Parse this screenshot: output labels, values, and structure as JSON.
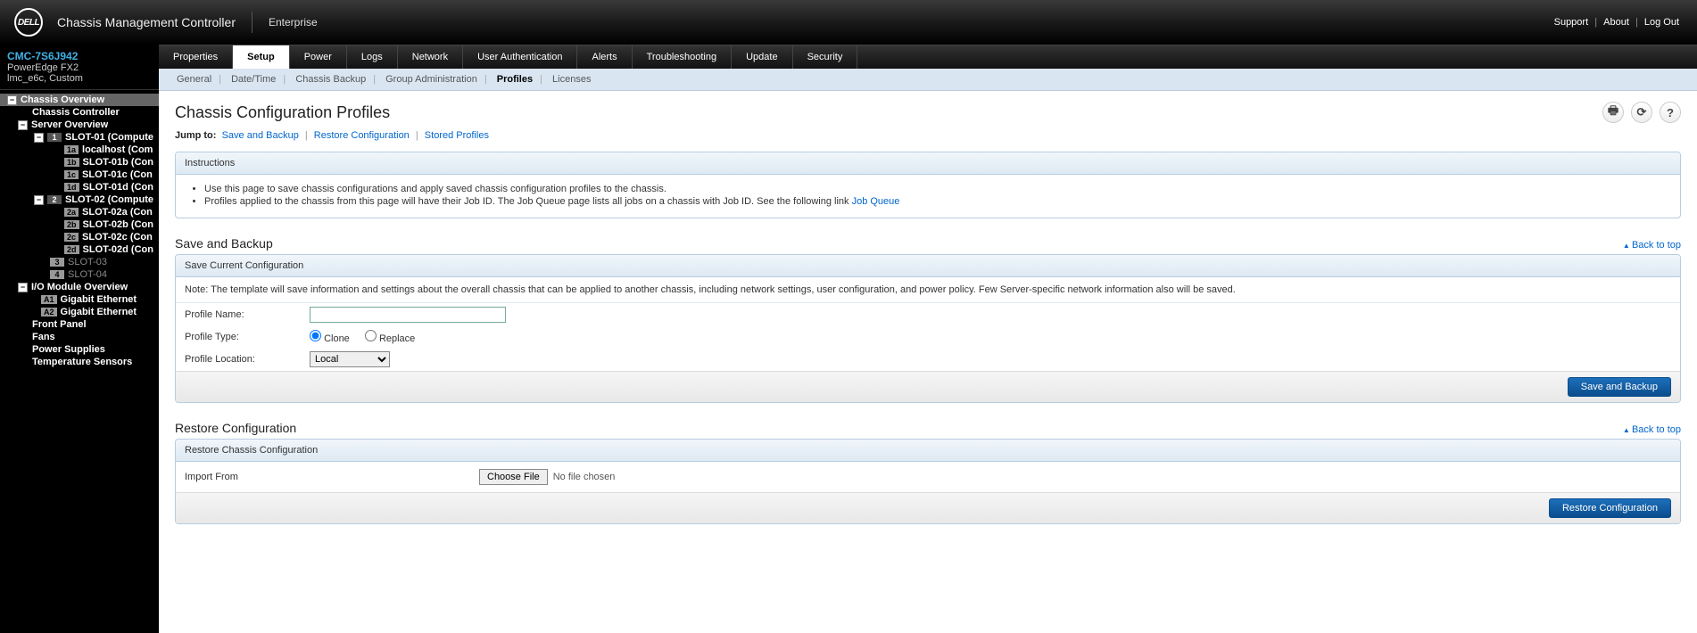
{
  "header": {
    "logo_text": "DELL",
    "title": "Chassis Management Controller",
    "subtitle": "Enterprise",
    "links": {
      "support": "Support",
      "about": "About",
      "logout": "Log Out"
    }
  },
  "sidebar": {
    "device": "CMC-7S6J942",
    "model": "PowerEdge FX2",
    "extra": "lmc_e6c, Custom",
    "tree": {
      "chassis_overview": "Chassis Overview",
      "chassis_controller": "Chassis Controller",
      "server_overview": "Server Overview",
      "slot01": {
        "badge": "1",
        "label": "SLOT-01 (Compute"
      },
      "slot01a": {
        "badge": "1a",
        "label": "localhost (Com"
      },
      "slot01b": {
        "badge": "1b",
        "label": "SLOT-01b (Con"
      },
      "slot01c": {
        "badge": "1c",
        "label": "SLOT-01c (Con"
      },
      "slot01d": {
        "badge": "1d",
        "label": "SLOT-01d (Con"
      },
      "slot02": {
        "badge": "2",
        "label": "SLOT-02 (Compute"
      },
      "slot02a": {
        "badge": "2a",
        "label": "SLOT-02a (Con"
      },
      "slot02b": {
        "badge": "2b",
        "label": "SLOT-02b (Con"
      },
      "slot02c": {
        "badge": "2c",
        "label": "SLOT-02c (Con"
      },
      "slot02d": {
        "badge": "2d",
        "label": "SLOT-02d (Con"
      },
      "slot03": {
        "badge": "3",
        "label": "SLOT-03"
      },
      "slot04": {
        "badge": "4",
        "label": "SLOT-04"
      },
      "io_overview": "I/O Module Overview",
      "ioA1": {
        "badge": "A1",
        "label": "Gigabit Ethernet"
      },
      "ioA2": {
        "badge": "A2",
        "label": "Gigabit Ethernet"
      },
      "front_panel": "Front Panel",
      "fans": "Fans",
      "power_supplies": "Power Supplies",
      "temp_sensors": "Temperature Sensors"
    }
  },
  "tabs": {
    "main": [
      "Properties",
      "Setup",
      "Power",
      "Logs",
      "Network",
      "User Authentication",
      "Alerts",
      "Troubleshooting",
      "Update",
      "Security"
    ],
    "active_main": "Setup",
    "sub": [
      "General",
      "Date/Time",
      "Chassis Backup",
      "Group Administration",
      "Profiles",
      "Licenses"
    ],
    "active_sub": "Profiles"
  },
  "page": {
    "title": "Chassis Configuration Profiles",
    "jump_label": "Jump to:",
    "jump_links": [
      "Save and Backup",
      "Restore Configuration",
      "Stored Profiles"
    ],
    "back_to_top": "Back to top"
  },
  "instructions": {
    "header": "Instructions",
    "line1": "Use this page to save chassis configurations and apply saved chassis configuration profiles to the chassis.",
    "line2a": "Profiles applied to the chassis from this page will have their Job ID. The Job Queue page lists all jobs on a chassis with Job ID. See the following link ",
    "line2_link": "Job Queue"
  },
  "save_backup": {
    "section_title": "Save and Backup",
    "panel_header": "Save Current Configuration",
    "note": "Note: The template will save information and settings about the overall chassis that can be applied to another chassis, including network settings, user configuration, and power policy. Few Server-specific network information also will be saved.",
    "profile_name_label": "Profile Name:",
    "profile_name_value": "",
    "profile_type_label": "Profile Type:",
    "profile_type_clone": "Clone",
    "profile_type_replace": "Replace",
    "profile_location_label": "Profile Location:",
    "profile_location_value": "Local",
    "button": "Save and Backup"
  },
  "restore": {
    "section_title": "Restore Configuration",
    "panel_header": "Restore Chassis Configuration",
    "import_label": "Import From",
    "choose_file": "Choose File",
    "no_file": "No file chosen",
    "button": "Restore Configuration"
  }
}
